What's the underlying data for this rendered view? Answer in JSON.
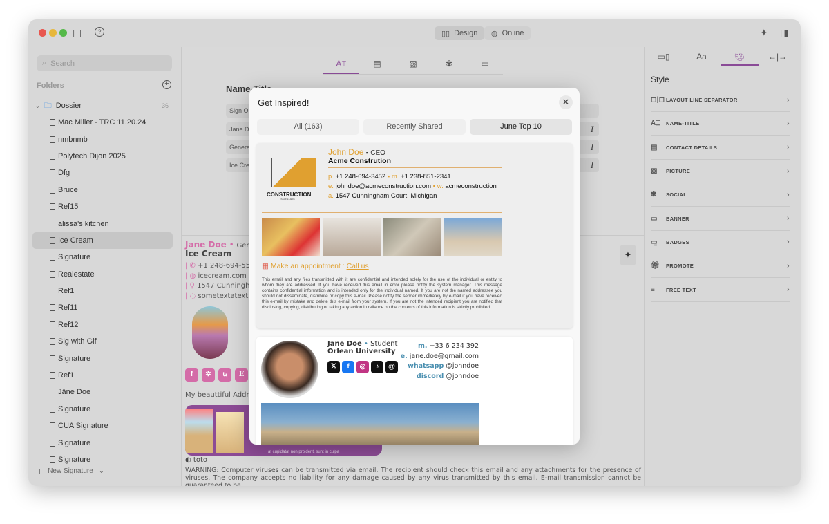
{
  "titlebar": {
    "design": "Design",
    "online": "Online"
  },
  "sidebar": {
    "search_placeholder": "Search",
    "folders_label": "Folders",
    "folder": {
      "name": "Dossier",
      "count": "36"
    },
    "items": [
      "Mac Miller - TRC 11.20.24",
      "nmbnmb",
      "Polytech Dijon 2025",
      "Dfg",
      "Bruce",
      "Ref15",
      "alissa's kitchen",
      "Ice Cream",
      "Signature",
      "Realestate",
      "Ref1",
      "Ref11",
      "Ref12",
      "Sig with Gif",
      "Signature",
      "Ref1",
      "Jäne Doe",
      "Signature",
      "CUA Signature",
      "Signature",
      "Signature"
    ],
    "selected": "Ice Cream",
    "new_signature": "New Signature"
  },
  "editor": {
    "section_title": "Name-Title",
    "rows": [
      "Sign O",
      "Jane D",
      "Genera",
      "Ice Cre"
    ]
  },
  "preview": {
    "name": "Jane Doe",
    "title": "Gene",
    "company": "Ice Cream",
    "phone": "+1 248-694-555",
    "web": "icecream.com",
    "address": "1547 Cunningha",
    "whatsapp": "sometextatext1",
    "logo_text": "Ice Cream",
    "address_label": "My beauttiful Addres",
    "banner_text": "at cupidatat non proident, sunt in culpa",
    "footer_name": "toto",
    "warning": "WARNING: Computer viruses can be transmitted via email. The recipient should check this email and any attachments for the presence of viruses. The company accepts no liability for any damage caused by any virus transmitted by this email. E-mail transmission cannot be guaranteed to be"
  },
  "right_panel": {
    "style_title": "Style",
    "tabs": [
      "layout",
      "Aa",
      "palette",
      "spacing"
    ],
    "items": [
      "LAYOUT LINE SEPARATOR",
      "NAME-TITLE",
      "CONTACT DETAILS",
      "PICTURE",
      "SOCIAL",
      "BANNER",
      "BADGES",
      "PROMOTE",
      "FREE TEXT"
    ]
  },
  "modal": {
    "title": "Get Inspired!",
    "tabs": [
      "All (163)",
      "Recently Shared",
      "June Top 10"
    ],
    "active_tab": "June Top 10",
    "card1": {
      "name": "John Doe",
      "title": "CEO",
      "company": "Acme Constrution",
      "logo_text": "CONSTRUCTION",
      "logo_tagline": "TAGLINE HERE",
      "p_label": "p.",
      "phone": "+1 248-694-3452",
      "m_label": "m.",
      "mobile": "+1 238-851-2341",
      "e_label": "e.",
      "email": "johndoe@acmeconstruction.com",
      "w_label": "w.",
      "web": "acmeconstruction",
      "a_label": "a.",
      "address": "1547 Cunningham Court, Michigan",
      "cta": "Make an appointment : ",
      "cta_link": "Call us",
      "disclaimer": "This email and any files transmitted with it are confidential and intended solely for the use of the individual or entity to whom they are addressed. If you have received this email in error please notify the system manager. This message contains confidential information and is intended only for the individual named. If you are not the named addressee you should not disseminate, distribute or copy this e-mail. Please notify the sender immediately by e-mail if you have received this e-mail by mistake and delete this e-mail from your system. If you are not the intended recipient you are notified that disclosing, copying, distributing or taking any action in reliance on the contents of this information is strictly prohibited."
    },
    "card2": {
      "name": "Jane Doe",
      "title": "Student",
      "company": "Orlean University",
      "m_label": "m.",
      "mobile": "+33 6 234 392",
      "e_label": "e.",
      "email": "jane.doe@gmail.com",
      "wa_label": "whatsapp",
      "wa": "@johndoe",
      "dc_label": "discord",
      "dc": "@johndoe"
    }
  },
  "colors": {
    "accent": "#8a4b97",
    "orange": "#e0a030",
    "pink": "#d46ca8",
    "blue": "#4a8fb0"
  }
}
